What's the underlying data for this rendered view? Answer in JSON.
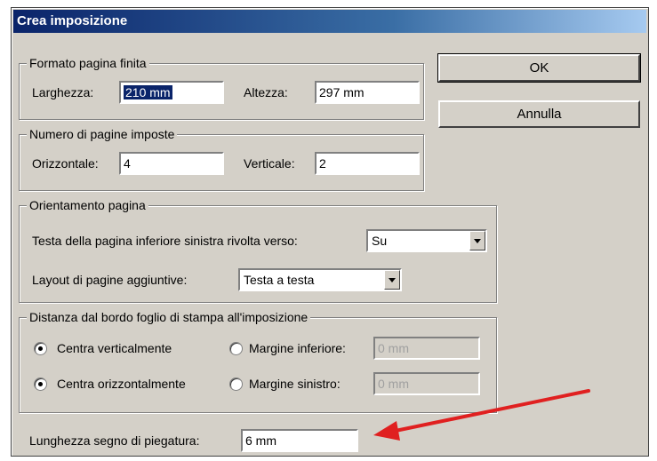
{
  "window": {
    "title": "Crea imposizione"
  },
  "buttons": {
    "ok": "OK",
    "cancel": "Annulla"
  },
  "formato": {
    "legend": "Formato pagina finita",
    "larghezza_label": "Larghezza:",
    "larghezza_value": "210 mm",
    "altezza_label": "Altezza:",
    "altezza_value": "297 mm"
  },
  "numero": {
    "legend": "Numero di pagine imposte",
    "orizzontale_label": "Orizzontale:",
    "orizzontale_value": "4",
    "verticale_label": "Verticale:",
    "verticale_value": "2"
  },
  "orientamento": {
    "legend": "Orientamento pagina",
    "testa_label": "Testa della pagina inferiore sinistra rivolta verso:",
    "testa_value": "Su",
    "layout_label": "Layout di pagine aggiuntive:",
    "layout_value": "Testa a testa"
  },
  "distanza": {
    "legend": "Distanza dal bordo foglio di stampa all'imposizione",
    "centra_vert": "Centra verticalmente",
    "margine_inf_label": "Margine inferiore:",
    "margine_inf_value": "0 mm",
    "centra_orizz": "Centra orizzontalmente",
    "margine_sin_label": "Margine sinistro:",
    "margine_sin_value": "0 mm"
  },
  "piegatura": {
    "label": "Lunghezza segno di piegatura:",
    "value": "6 mm"
  },
  "annotation": {
    "arrow_color": "#e02020",
    "icon": "red-arrow-icon"
  }
}
